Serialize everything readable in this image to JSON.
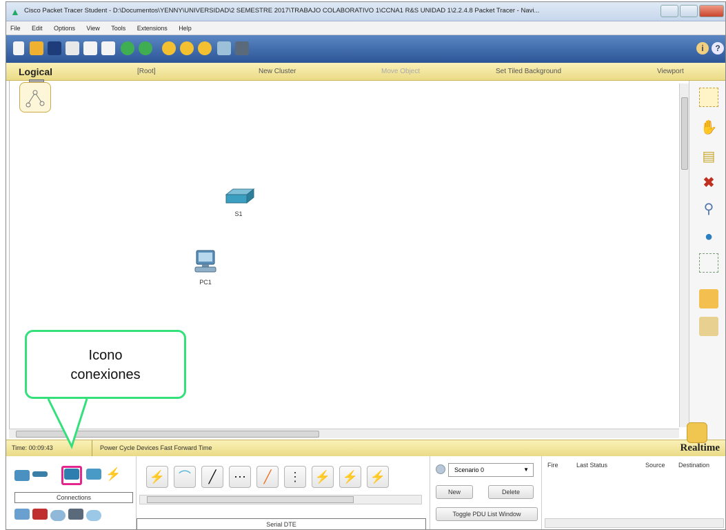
{
  "window": {
    "title": "Cisco Packet Tracer Student - D:\\Documentos\\YENNY\\UNIVERSIDAD\\2 SEMESTRE 2017\\TRABAJO COLABORATIVO 1\\CCNA1 R&S UNIDAD 1\\2.2.4.8 Packet Tracer - Navi..."
  },
  "menu": [
    "File",
    "Edit",
    "Options",
    "View",
    "Tools",
    "Extensions",
    "Help"
  ],
  "toolbar": {
    "icons": [
      "new-icon",
      "open-icon",
      "save-icon",
      "print-icon",
      "activity-wizard-icon",
      "copy-icon",
      "undo-icon",
      "redo-icon",
      "zoom-in-icon",
      "zoom-reset-icon",
      "zoom-out-icon",
      "palette-icon",
      "custom-devices-icon",
      "info-icon",
      "help-icon"
    ],
    "help": "?"
  },
  "logical_bar": {
    "logical": "Logical",
    "root": "[Root]",
    "new_cluster": "New Cluster",
    "move_object": "Move Object",
    "set_tiled_background": "Set Tiled Background",
    "viewport": "Viewport"
  },
  "devices": [
    {
      "label": "S1",
      "type": "switch-icon"
    },
    {
      "label": "PC1",
      "type": "pc-icon"
    }
  ],
  "status": {
    "time": "Time: 00:09:43",
    "power_cycle": "Power Cycle Devices",
    "fast_forward": "Fast Forward Time",
    "realtime": "Realtime"
  },
  "device_categories": {
    "label": "Connections"
  },
  "connections": {
    "label": "Serial DTE",
    "types": [
      "auto-connection-icon",
      "console-cable-icon",
      "copper-straight-icon",
      "copper-cross-icon",
      "fiber-icon",
      "phone-cable-icon",
      "coaxial-icon",
      "serial-dce-icon",
      "serial-dte-icon"
    ]
  },
  "scenario": {
    "selected": "Scenario 0",
    "new": "New",
    "delete": "Delete",
    "toggle": "Toggle PDU List Window"
  },
  "pdu_list": {
    "columns": [
      "Fire",
      "Last Status",
      "Source",
      "Destination"
    ]
  },
  "callout": {
    "line1": "Icono",
    "line2": "conexiones"
  },
  "colors": {
    "toolbar_blue": "#2c5597",
    "logical_yellow": "#eadb86",
    "highlight_pink": "#e4258d",
    "callout_green": "#33e07a"
  }
}
